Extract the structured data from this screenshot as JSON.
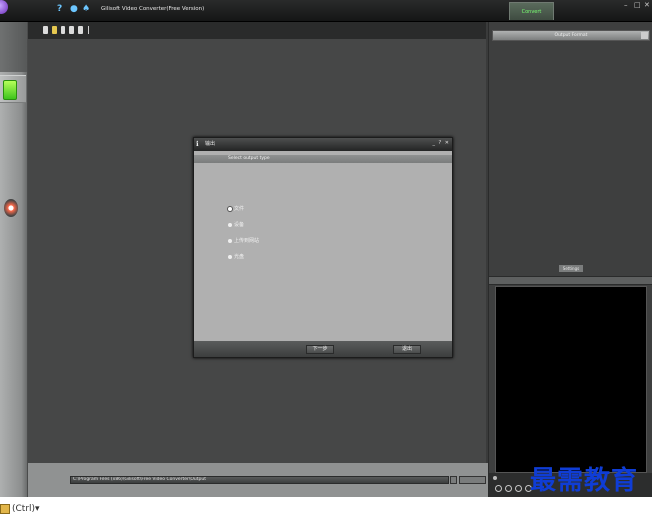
{
  "titlebar": {
    "app_title": "Gilisoft Video Converter(Free Version)",
    "convert_label": "Convert",
    "icons": [
      "help-icon",
      "globe-icon",
      "update-icon"
    ],
    "window_controls": [
      "minimize-icon",
      "maximize-icon",
      "close-icon"
    ]
  },
  "toolbar": {
    "icons": [
      "add-file-icon",
      "add-folder-icon",
      "add-url-icon",
      "add-dvd-icon",
      "remove-icon"
    ]
  },
  "sidebar": {
    "items": [
      {
        "name": "video-tool",
        "icon": "video-file-icon"
      },
      {
        "name": "dvd-tool",
        "icon": "dvd-icon"
      }
    ]
  },
  "right_panel": {
    "output_format_label": "Output Format",
    "settings_label": "Settings"
  },
  "dialog": {
    "title": "输出",
    "subtitle": "Select output type",
    "options": [
      "文件",
      "设备",
      "上传到网站",
      "光盘"
    ],
    "selected_index": 0,
    "next_label": "下一步",
    "exit_label": "退出"
  },
  "bottombar": {
    "output_path": "C:\\Program Files (x86)\\Gilisoft\\Free Video Converter\\Output"
  },
  "watermark": "最需教育",
  "taskbar": {
    "clipboard_label": "(Ctrl)"
  },
  "colors": {
    "convert_text": "#79ff72",
    "watermark": "#0f3dd6",
    "background": "#3a3b3b"
  }
}
